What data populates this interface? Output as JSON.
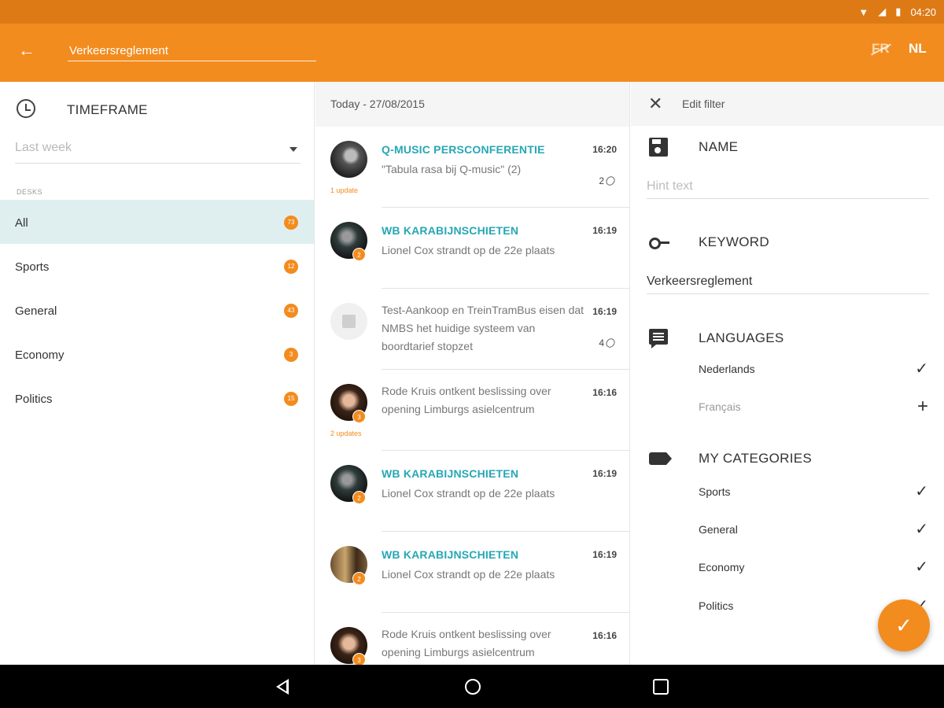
{
  "status_bar": {
    "time": "04:20"
  },
  "app_bar": {
    "search_value": "Verkeersreglement",
    "lang_fr": "FR",
    "lang_nl": "NL"
  },
  "timeframe": {
    "title": "TIMEFRAME",
    "selected": "Last week"
  },
  "desks": {
    "label": "DESKS",
    "items": [
      {
        "label": "All",
        "count": "73",
        "active": true
      },
      {
        "label": "Sports",
        "count": "12"
      },
      {
        "label": "General",
        "count": "43"
      },
      {
        "label": "Economy",
        "count": "3"
      },
      {
        "label": "Politics",
        "count": "15"
      }
    ]
  },
  "news": {
    "date_header": "Today - 27/08/2015",
    "items": [
      {
        "title": "Q-MUSIC PERSCONFERENTIE",
        "body": "\"Tabula rasa bij Q-music\" (2)",
        "time": "16:20",
        "attachments": "2",
        "update": "1 update"
      },
      {
        "title": "WB KARABIJNSCHIETEN",
        "body": "Lionel Cox strandt op de 22e plaats",
        "time": "16:19",
        "avatar_badge": "2"
      },
      {
        "title": "",
        "body": "Test-Aankoop en TreinTramBus eisen dat NMBS het huidige systeem van boordtarief stopzet",
        "time": "16:19",
        "attachments": "4"
      },
      {
        "title": "",
        "body": "Rode Kruis ontkent beslissing over opening Limburgs asielcentrum",
        "time": "16:16",
        "avatar_badge": "3",
        "update": "2 updates"
      },
      {
        "title": "WB KARABIJNSCHIETEN",
        "body": "Lionel Cox strandt op de 22e plaats",
        "time": "16:19",
        "avatar_badge": "2"
      },
      {
        "title": "WB KARABIJNSCHIETEN",
        "body": "Lionel Cox strandt op de 22e plaats",
        "time": "16:19",
        "avatar_badge": "2"
      },
      {
        "title": "",
        "body": "Rode Kruis ontkent beslissing over opening Limburgs asielcentrum",
        "time": "16:16",
        "avatar_badge": "3"
      }
    ]
  },
  "edit_filter": {
    "header": "Edit filter",
    "name_title": "NAME",
    "name_placeholder": "Hint text",
    "keyword_title": "KEYWORD",
    "keyword_value": "Verkeersreglement",
    "languages_title": "LANGUAGES",
    "languages": [
      {
        "label": "Nederlands",
        "state": "checked"
      },
      {
        "label": "Français",
        "state": "add"
      }
    ],
    "categories_title": "MY CATEGORIES",
    "categories": [
      {
        "label": "Sports",
        "state": "checked"
      },
      {
        "label": "General",
        "state": "checked"
      },
      {
        "label": "Economy",
        "state": "checked"
      },
      {
        "label": "Politics",
        "state": "checked"
      }
    ]
  },
  "colors": {
    "accent": "#f28c1e",
    "status_bar": "#dd7a15",
    "teal": "#26a7b5",
    "selected_row": "#dfeff0"
  },
  "icons": {
    "check": "✓",
    "plus": "+",
    "close": "✕",
    "arrow_back": "←"
  }
}
